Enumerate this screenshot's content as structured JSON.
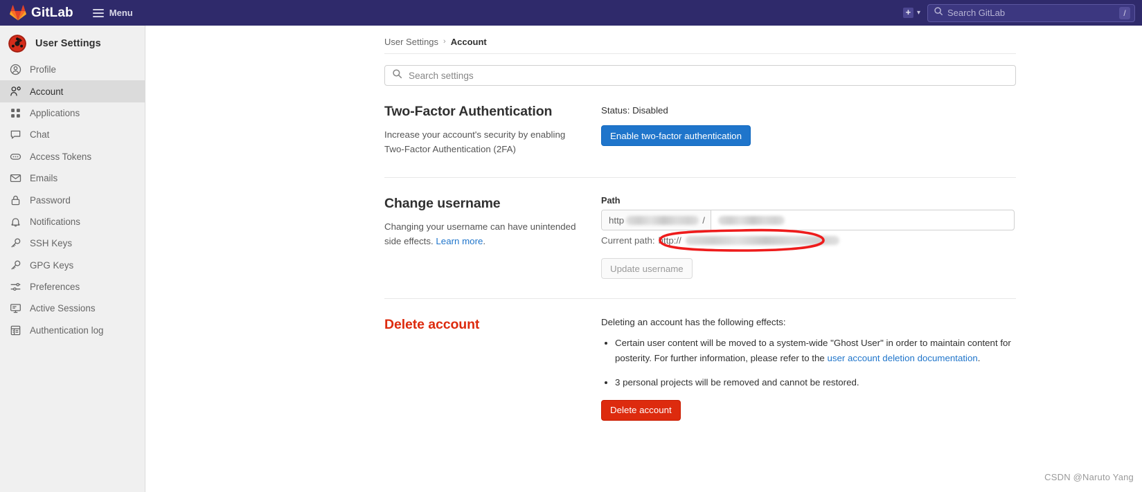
{
  "topbar": {
    "brand_name": "GitLab",
    "menu_label": "Menu",
    "new_label": "+",
    "search_placeholder": "Search GitLab",
    "search_value": "",
    "search_shortcut": "/",
    "bg_color": "#2f2a6b"
  },
  "sidebar": {
    "title": "User Settings",
    "items": [
      {
        "label": "Profile",
        "icon": "user-circle-icon",
        "active": false
      },
      {
        "label": "Account",
        "icon": "account-key-icon",
        "active": true
      },
      {
        "label": "Applications",
        "icon": "grid-apps-icon",
        "active": false
      },
      {
        "label": "Chat",
        "icon": "chat-bubble-icon",
        "active": false
      },
      {
        "label": "Access Tokens",
        "icon": "token-pill-icon",
        "active": false
      },
      {
        "label": "Emails",
        "icon": "envelope-icon",
        "active": false
      },
      {
        "label": "Password",
        "icon": "lock-icon",
        "active": false
      },
      {
        "label": "Notifications",
        "icon": "bell-icon",
        "active": false
      },
      {
        "label": "SSH Keys",
        "icon": "key-icon",
        "active": false
      },
      {
        "label": "GPG Keys",
        "icon": "key-icon",
        "active": false
      },
      {
        "label": "Preferences",
        "icon": "sliders-icon",
        "active": false
      },
      {
        "label": "Active Sessions",
        "icon": "monitor-icon",
        "active": false
      },
      {
        "label": "Authentication log",
        "icon": "table-log-icon",
        "active": false
      }
    ]
  },
  "breadcrumb": {
    "parent": "User Settings",
    "separator": "›",
    "current": "Account"
  },
  "settings_search": {
    "placeholder": "Search settings",
    "value": "",
    "icon": "search-icon"
  },
  "two_factor": {
    "title": "Two-Factor Authentication",
    "description": "Increase your account's security by enabling Two-Factor Authentication (2FA)",
    "status": "Status: Disabled",
    "enable_button": "Enable two-factor authentication",
    "button_color": "#1f75cb"
  },
  "change_username": {
    "title": "Change username",
    "description_before": "Changing your username can have unintended side effects. ",
    "learn_more": "Learn more",
    "description_after": ".",
    "path_label": "Path",
    "prefix_visible_text": "http",
    "prefix_redacted": true,
    "prefix_separator": "/",
    "username_value_redacted": true,
    "current_path_label": "Current path:",
    "current_path_prefix": "http://",
    "current_path_redacted": true,
    "update_button": "Update username",
    "update_button_disabled": true,
    "annotation": "red-ellipse-highlight",
    "annotation_color": "#ee1c1c"
  },
  "delete_account": {
    "title": "Delete account",
    "title_color": "#dd2b0e",
    "intro": "Deleting an account has the following effects:",
    "effects": [
      {
        "text_before": "Certain user content will be moved to a system-wide \"Ghost User\" in order to maintain content for posterity. For further information, please refer to the ",
        "link": "user account deletion documentation",
        "text_after": "."
      },
      {
        "text_before": "3 personal projects will be removed and cannot be restored.",
        "link": "",
        "text_after": ""
      }
    ],
    "delete_button": "Delete account",
    "button_color": "#dd2b0e"
  },
  "watermark": "CSDN @Naruto Yang"
}
